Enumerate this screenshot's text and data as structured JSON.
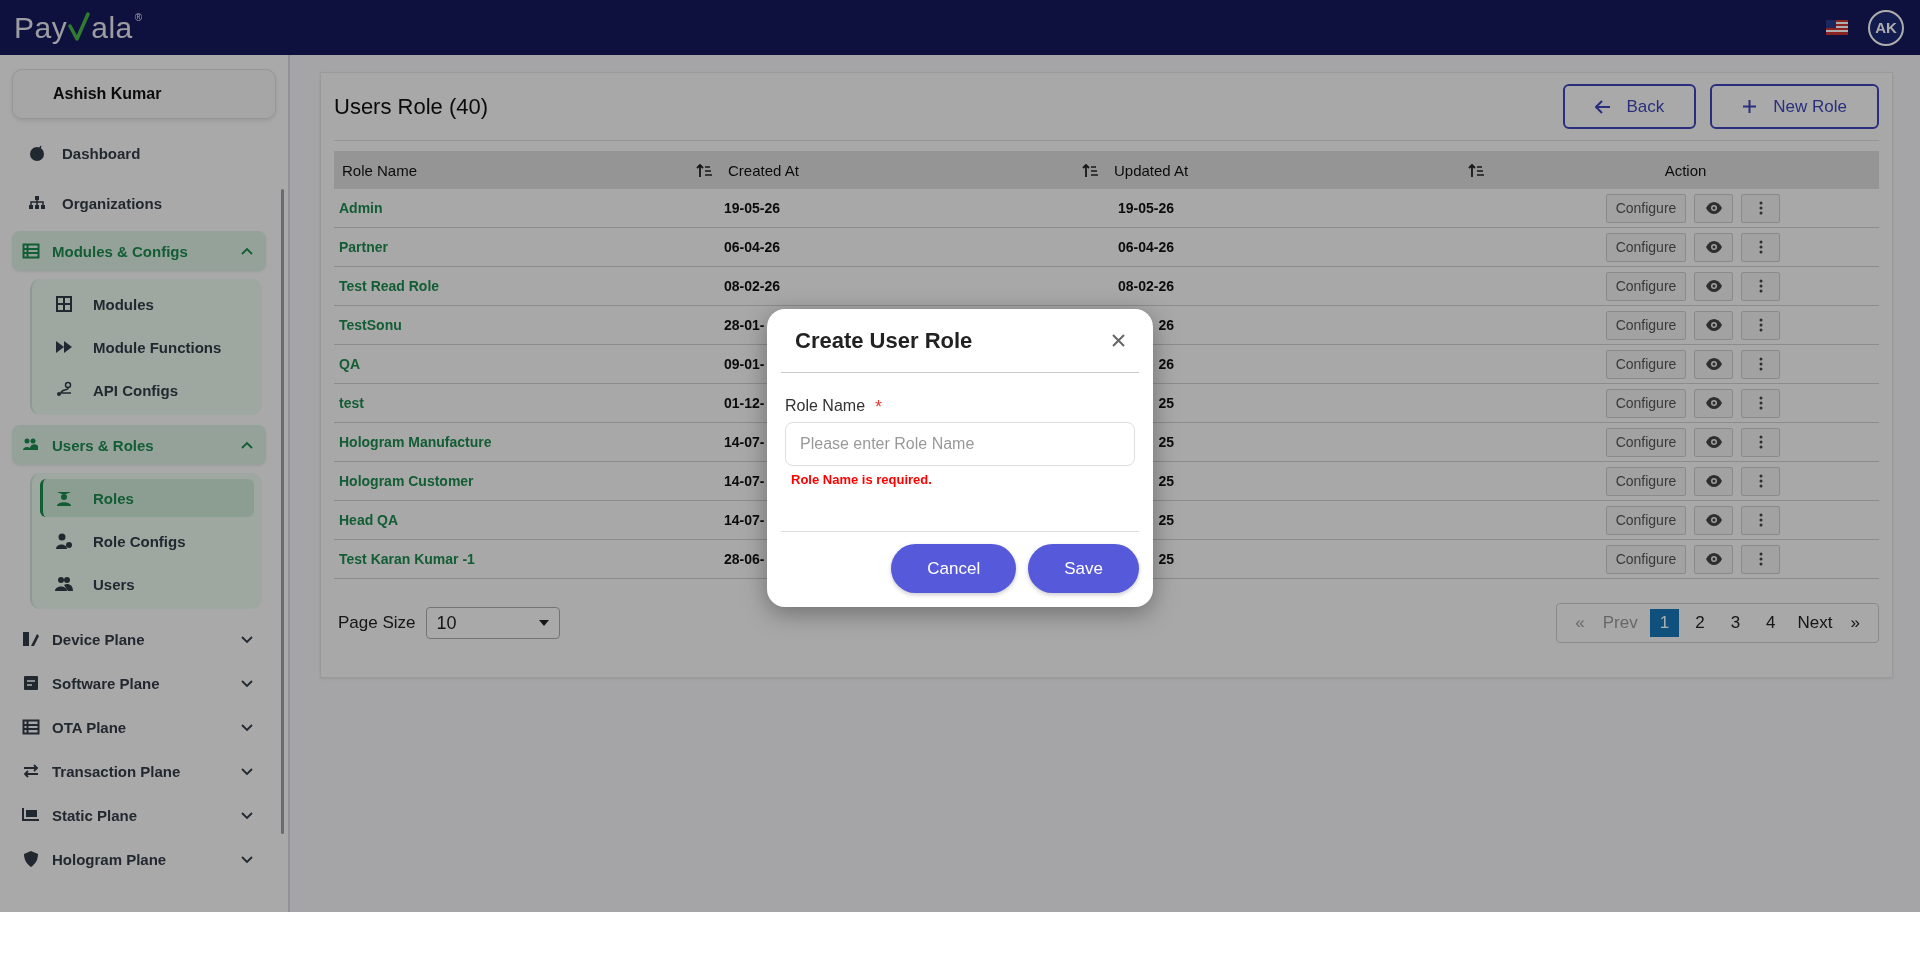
{
  "header": {
    "logo": {
      "before": "Pay",
      "after": "ala",
      "mark": "®"
    },
    "avatar": "AK"
  },
  "sidebar": {
    "user_name": "Ashish Kumar",
    "items": [
      {
        "label": "Dashboard",
        "kind": "link",
        "selected": false
      },
      {
        "label": "Organizations",
        "kind": "link",
        "selected": false
      },
      {
        "label": "Modules & Configs",
        "kind": "group",
        "expanded": true,
        "children": [
          {
            "label": "Modules",
            "selected": false
          },
          {
            "label": "Module Functions",
            "selected": false
          },
          {
            "label": "API Configs",
            "selected": false
          }
        ]
      },
      {
        "label": "Users & Roles",
        "kind": "group",
        "expanded": true,
        "children": [
          {
            "label": "Roles",
            "selected": true
          },
          {
            "label": "Role Configs",
            "selected": false
          },
          {
            "label": "Users",
            "selected": false
          }
        ]
      },
      {
        "label": "Device Plane",
        "kind": "group",
        "expanded": false
      },
      {
        "label": "Software Plane",
        "kind": "group",
        "expanded": false
      },
      {
        "label": "OTA Plane",
        "kind": "group",
        "expanded": false
      },
      {
        "label": "Transaction Plane",
        "kind": "group",
        "expanded": false
      },
      {
        "label": "Static Plane",
        "kind": "group",
        "expanded": false
      },
      {
        "label": "Hologram Plane",
        "kind": "group",
        "expanded": false
      }
    ]
  },
  "page": {
    "title": "Users Role (40)",
    "buttons": [
      {
        "label": "Back",
        "kind": "back"
      },
      {
        "label": "New Role",
        "kind": "add"
      }
    ]
  },
  "table": {
    "columns": [
      {
        "label": "Role Name",
        "sortable": true
      },
      {
        "label": "Created At",
        "sortable": true
      },
      {
        "label": "Updated At",
        "sortable": true
      },
      {
        "label": "Action",
        "sortable": false
      }
    ],
    "rows": [
      {
        "role_name": "Admin",
        "created_at": "19-05-26",
        "updated_at": "19-05-26",
        "action": "Configure"
      },
      {
        "role_name": "Partner",
        "created_at": "06-04-26",
        "updated_at": "06-04-26",
        "action": "Configure"
      },
      {
        "role_name": "Test Read Role",
        "created_at": "08-02-26",
        "updated_at": "08-02-26",
        "action": "Configure"
      },
      {
        "role_name": "TestSonu",
        "created_at": "28-01-",
        "updated_at": "26",
        "action": "Configure"
      },
      {
        "role_name": "QA",
        "created_at": "09-01-",
        "updated_at": "26",
        "action": "Configure"
      },
      {
        "role_name": "test",
        "created_at": "01-12-",
        "updated_at": "25",
        "action": "Configure"
      },
      {
        "role_name": "Hologram Manufacture",
        "created_at": "14-07-",
        "updated_at": "25",
        "action": "Configure"
      },
      {
        "role_name": "Hologram Customer",
        "created_at": "14-07-",
        "updated_at": "25",
        "action": "Configure"
      },
      {
        "role_name": "Head QA",
        "created_at": "14-07-",
        "updated_at": "25",
        "action": "Configure"
      },
      {
        "role_name": "Test Karan Kumar -1",
        "created_at": "28-06-",
        "updated_at": "25",
        "action": "Configure"
      }
    ]
  },
  "page_size": {
    "label": "Page Size",
    "value": "10"
  },
  "pagination": {
    "first": "«",
    "prev": "Prev",
    "prev_disabled": true,
    "pages": [
      {
        "label": "1",
        "selected": true
      },
      {
        "label": "2",
        "selected": false
      },
      {
        "label": "3",
        "selected": false
      },
      {
        "label": "4",
        "selected": false
      }
    ],
    "next": "Next",
    "last": "»"
  },
  "modal": {
    "title": "Create User Role",
    "field": {
      "label": "Role Name",
      "required": "*",
      "placeholder": "Please enter Role Name",
      "error": "Role Name is required."
    },
    "buttons": [
      {
        "label": "Cancel"
      },
      {
        "label": "Save"
      }
    ]
  }
}
